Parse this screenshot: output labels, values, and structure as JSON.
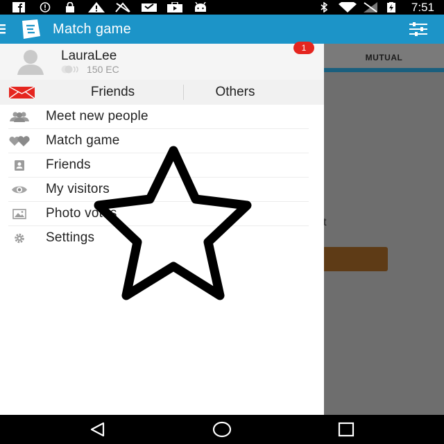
{
  "status_bar": {
    "time": "7:51",
    "left_icons": [
      "facebook-icon",
      "alert-circle-icon",
      "lock-icon",
      "warning-icon",
      "no-signal-icon",
      "inbox-icon",
      "briefcase-play-icon",
      "android-icon"
    ],
    "right_icons": [
      "bluetooth-icon",
      "wifi-icon",
      "cellular-off-icon",
      "battery-charging-icon"
    ]
  },
  "app_bar": {
    "title": "Match game",
    "menu_icon": "hamburger-icon",
    "logo_icon": "app-logo-icon",
    "filter_icon": "sliders-icon"
  },
  "content": {
    "tab_label": "MUTUAL",
    "partial_text": "t"
  },
  "drawer": {
    "profile": {
      "name": "LauraLee",
      "credits": "150 EC"
    },
    "segments": {
      "friends_label": "Friends",
      "others_label": "Others",
      "others_badge": "1"
    },
    "menu": [
      {
        "label": "Meet new people",
        "icon": "people-icon"
      },
      {
        "label": "Match game",
        "icon": "hearts-icon"
      },
      {
        "label": "Friends",
        "icon": "contact-card-icon"
      },
      {
        "label": "My visitors",
        "icon": "eye-icon"
      },
      {
        "label": "Photo votes",
        "icon": "photos-icon"
      },
      {
        "label": "Settings",
        "icon": "gear-icon"
      }
    ]
  },
  "overlay": {
    "shape": "star-outline"
  },
  "nav_bar": {
    "icons": [
      "back-icon",
      "home-icon",
      "recents-icon"
    ]
  },
  "colors": {
    "app_bar": "#1c94c8",
    "badge": "#e5251f",
    "mail": "#e5251f",
    "tab_underline": "#1a5f7e",
    "partial_button": "#5e3b16"
  }
}
